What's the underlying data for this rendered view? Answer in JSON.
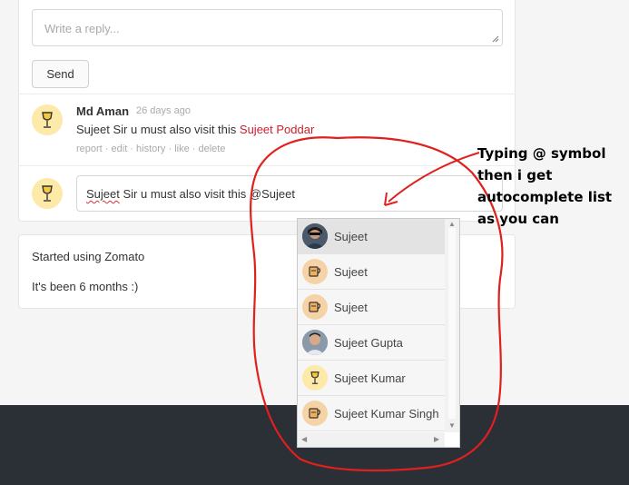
{
  "reply_form": {
    "placeholder": "Write a reply...",
    "send_label": "Send"
  },
  "comment": {
    "author": "Md Aman",
    "time": "26 days ago",
    "text_prefix": "Sujeet Sir u must also visit this ",
    "mention": "Sujeet Poddar",
    "actions": "report · edit · history · like · delete"
  },
  "reply_input": {
    "spellcheck_word": "Sujeet",
    "rest": " Sir u must also visit this @Sujeet"
  },
  "review_card": {
    "line1": "Started using Zomato",
    "line2": "It's been 6 months :)"
  },
  "autocomplete": {
    "items": [
      {
        "label": "Sujeet",
        "avatar": "photo"
      },
      {
        "label": "Sujeet",
        "avatar": "mug-icon"
      },
      {
        "label": "Sujeet",
        "avatar": "mug-icon"
      },
      {
        "label": "Sujeet Gupta",
        "avatar": "photo"
      },
      {
        "label": "Sujeet Kumar",
        "avatar": "wine-glass-icon"
      },
      {
        "label": "Sujeet Kumar Singh",
        "avatar": "mug-icon"
      }
    ]
  },
  "annotation": {
    "text": "Typing @ symbol then i get autocomplete list as you can",
    "color": "#e0201e"
  },
  "colors": {
    "mention": "#cb202d",
    "footer": "#2b2f36",
    "avatar_bg": "#fde9a8"
  }
}
